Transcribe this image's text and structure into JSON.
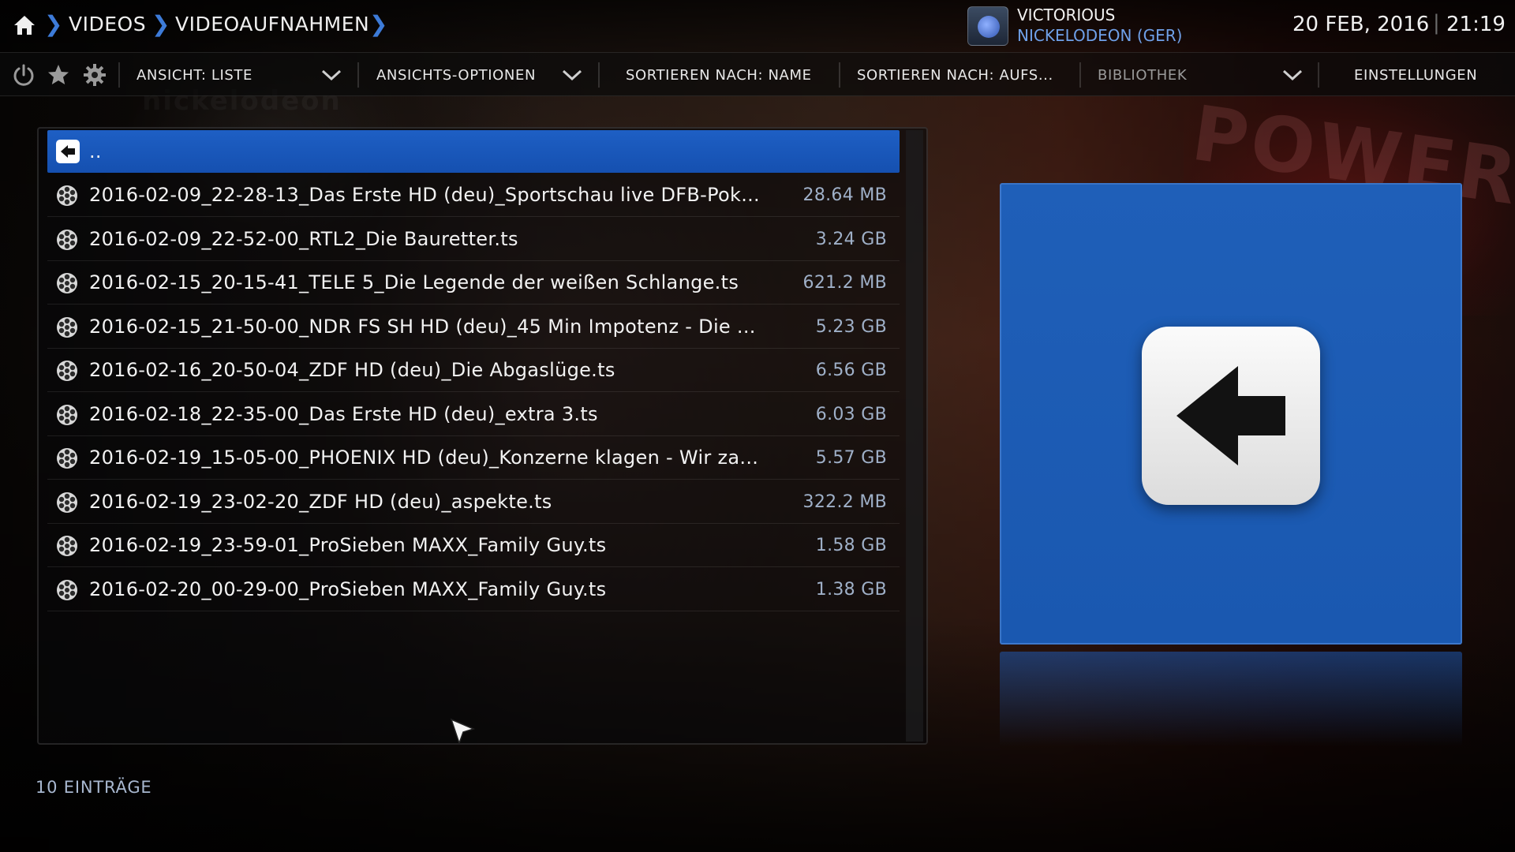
{
  "breadcrumb": {
    "items": [
      "VIDEOS",
      "VIDEOAUFNAHMEN"
    ]
  },
  "now_playing": {
    "title": "VICTORIOUS",
    "channel": "NICKELODEON (GER)"
  },
  "clock": {
    "date": "20 FEB, 2016",
    "separator": "|",
    "time": "21:19"
  },
  "toolbar": {
    "view_label": "ANSICHT: LISTE",
    "view_options_label": "ANSICHTS-OPTIONEN",
    "sort_by_label": "SORTIEREN NACH: NAME",
    "sort_order_label": "SORTIEREN NACH: AUFS...",
    "library_label": "BIBLIOTHEK",
    "settings_label": "EINSTELLUNGEN"
  },
  "list": {
    "parent_item_label": "..",
    "items": [
      {
        "name": "2016-02-09_22-28-13_Das Erste HD (deu)_Sportschau live  DFB-Pok...",
        "size": "28.64 MB"
      },
      {
        "name": "2016-02-09_22-52-00_RTL2_Die Bauretter.ts",
        "size": "3.24 GB"
      },
      {
        "name": "2016-02-15_20-15-41_TELE 5_Die Legende der weißen Schlange.ts",
        "size": "621.2 MB"
      },
      {
        "name": "2016-02-15_21-50-00_NDR FS SH HD (deu)_45 Min  Impotenz - Die ...",
        "size": "5.23 GB"
      },
      {
        "name": "2016-02-16_20-50-04_ZDF HD (deu)_Die Abgaslüge.ts",
        "size": "6.56 GB"
      },
      {
        "name": "2016-02-18_22-35-00_Das Erste HD (deu)_extra 3.ts",
        "size": "6.03 GB"
      },
      {
        "name": "2016-02-19_15-05-00_PHOENIX HD (deu)_Konzerne klagen - Wir za...",
        "size": "5.57 GB"
      },
      {
        "name": "2016-02-19_23-02-20_ZDF HD (deu)_aspekte.ts",
        "size": "322.2 MB"
      },
      {
        "name": "2016-02-19_23-59-01_ProSieben MAXX_Family Guy.ts",
        "size": "1.58 GB"
      },
      {
        "name": "2016-02-20_00-29-00_ProSieben MAXX_Family Guy.ts",
        "size": "1.38 GB"
      }
    ]
  },
  "footer": {
    "item_count": "10 EINTRÄGE"
  },
  "colors": {
    "accent": "#1e5fc4",
    "breadcrumb_separator": "#3d7bd8",
    "channel_text": "#6fa0e8",
    "size_text": "#9fb0c8"
  },
  "icons": {
    "home": "home-icon",
    "power": "power-icon",
    "favourites": "star-icon",
    "settings": "gear-icon",
    "parent_folder": "back-arrow-icon",
    "video_file": "film-reel-icon"
  }
}
